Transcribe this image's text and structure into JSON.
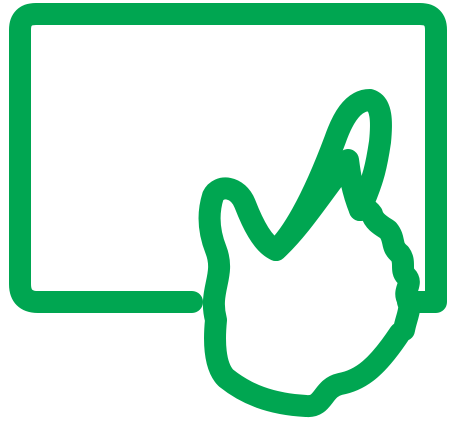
{
  "icon": {
    "name": "touchscreen-gesture-icon",
    "color": "#00A651"
  }
}
